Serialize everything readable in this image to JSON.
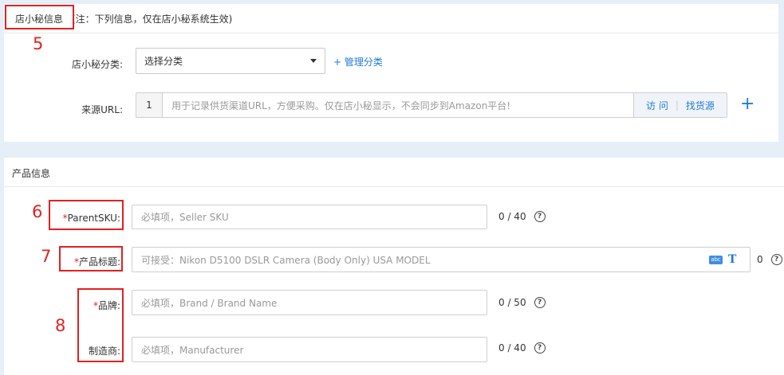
{
  "store_section": {
    "title": "店小秘信息",
    "note": "(注：下列信息，仅在店小秘系统生效)",
    "category": {
      "label": "店小秘分类:",
      "selected": "选择分类",
      "manage_link": "+ 管理分类"
    },
    "source_url": {
      "label": "来源URL:",
      "index": "1",
      "placeholder": "用于记录供货渠道URL，方便采购。仅在店小秘显示，不会同步到Amazon平台!",
      "visit_label": "访 问",
      "separator": "|",
      "find_label": "找货源",
      "add_icon": "+"
    }
  },
  "product_section": {
    "title": "产品信息",
    "parent_sku": {
      "required_mark": "*",
      "label": "ParentSKU:",
      "placeholder": "必填项，Seller SKU",
      "counter": "0 / 40"
    },
    "product_title": {
      "required_mark": "*",
      "label": "产品标题:",
      "placeholder": "可接受：Nikon D5100 DSLR Camera (Body Only) USA MODEL",
      "abc_icon": "abc",
      "format_icon": "T",
      "counter": "0"
    },
    "brand": {
      "required_mark": "*",
      "label": "品牌:",
      "placeholder": "必填项，Brand / Brand Name",
      "counter": "0 / 50"
    },
    "manufacturer": {
      "label": "制造商:",
      "placeholder": "必填项，Manufacturer",
      "counter": "0 / 40"
    },
    "help_icon": "?"
  },
  "annotations": {
    "a5": "5",
    "a6": "6",
    "a7": "7",
    "a8": "8"
  },
  "colors": {
    "link": "#1f7bd6",
    "required": "#e32020",
    "annotation": "#e32020",
    "background": "#e6eef8"
  }
}
